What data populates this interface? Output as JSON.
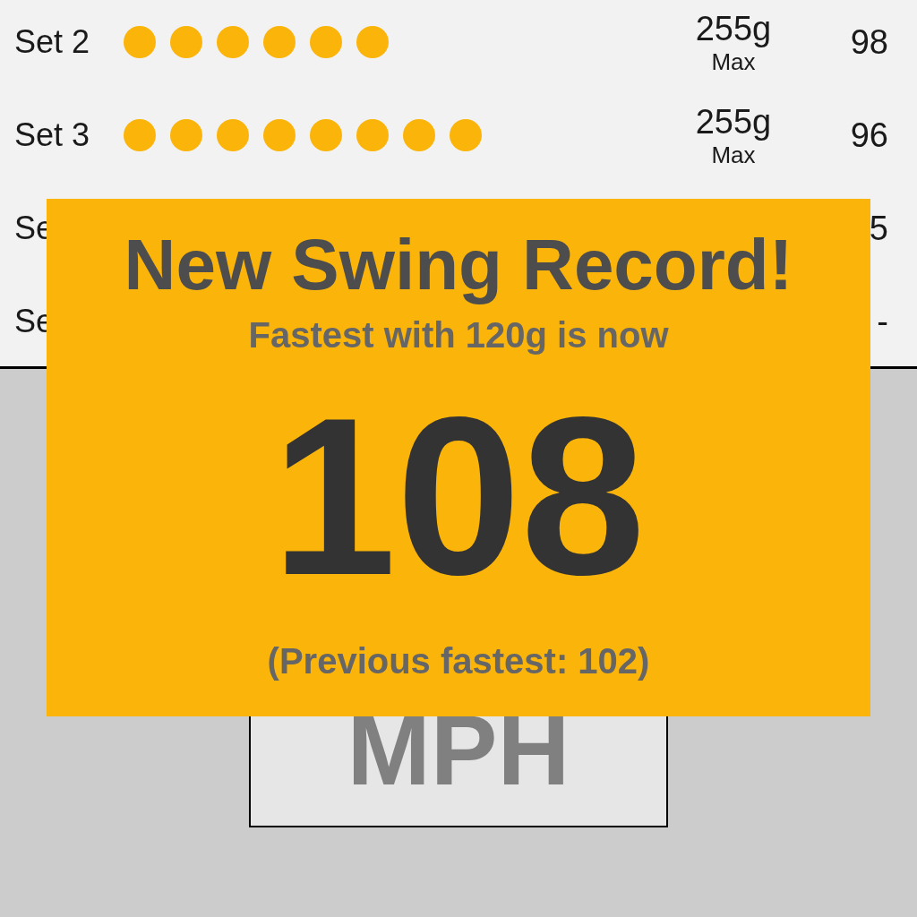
{
  "sets": [
    {
      "label": "Set 2",
      "swings": [
        {
          "kind": "swing"
        },
        {
          "kind": "swing"
        },
        {
          "kind": "swing"
        },
        {
          "kind": "swing"
        },
        {
          "kind": "swing"
        },
        {
          "kind": "swing"
        }
      ],
      "weight": "255g",
      "weight_note": "Max",
      "speed": "98"
    },
    {
      "label": "Set 3",
      "swings": [
        {
          "kind": "swing"
        },
        {
          "kind": "swing"
        },
        {
          "kind": "swing"
        },
        {
          "kind": "swing"
        },
        {
          "kind": "swing"
        },
        {
          "kind": "swing"
        },
        {
          "kind": "swing"
        },
        {
          "kind": "swing"
        }
      ],
      "weight": "255g",
      "weight_note": "Max",
      "speed": "96"
    },
    {
      "label": "Se",
      "speed": "5"
    },
    {
      "label": "Se",
      "speed": "-"
    }
  ],
  "unit": "MPH",
  "record": {
    "title": "New Swing Record!",
    "subtitle": "Fastest with 120g is now",
    "value": "108",
    "previous": "(Previous fastest: 102)"
  }
}
